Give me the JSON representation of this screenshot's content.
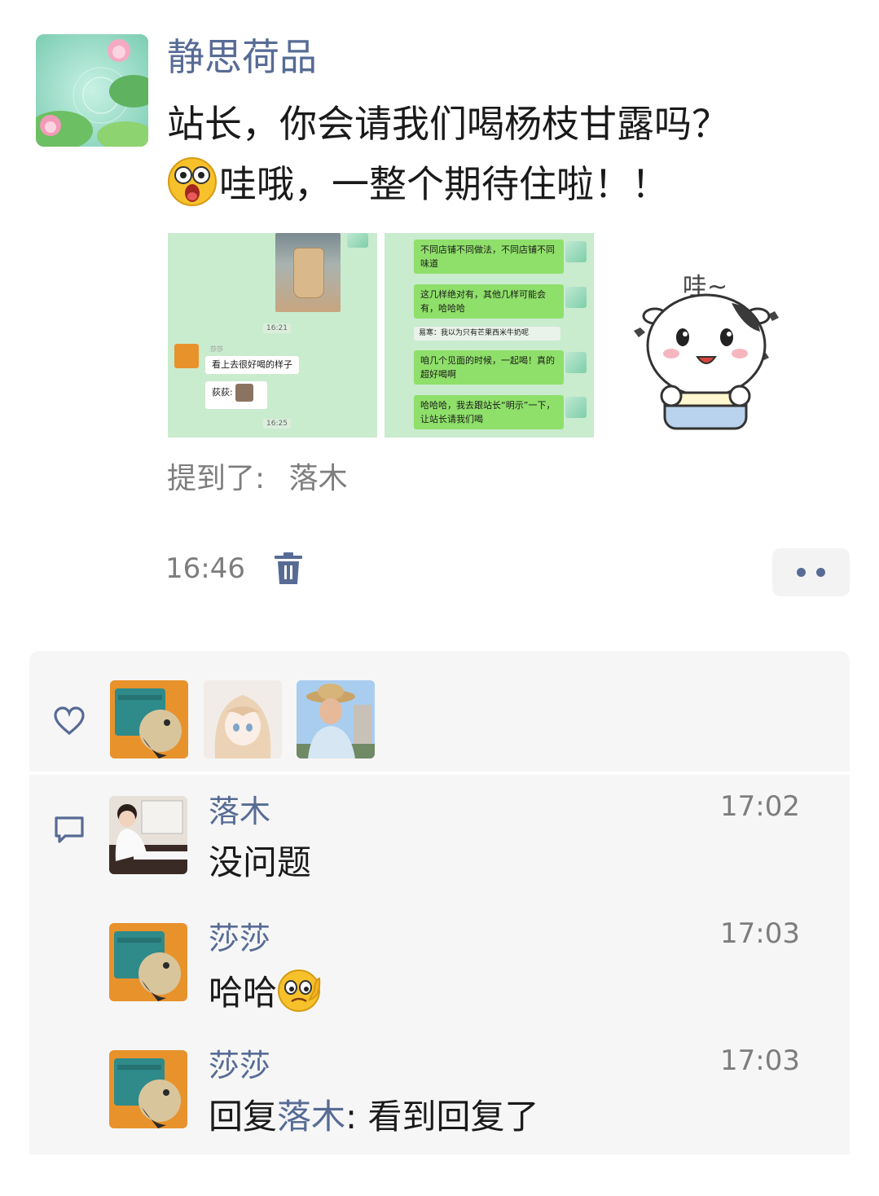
{
  "post": {
    "author": "静思荷品",
    "text_line1": "站长，你会请我们喝杨枝甘露吗？",
    "text_line2": "哇哦，一整个期待住啦！！",
    "images": [
      {
        "messages": [
          {
            "kind": "time",
            "text": "16:21"
          },
          {
            "kind": "name",
            "text": "莎莎"
          },
          {
            "kind": "bubble",
            "text": "看上去很好喝的样子"
          },
          {
            "kind": "bubble",
            "text": "荻荻:"
          },
          {
            "kind": "time",
            "text": "16:25"
          }
        ]
      },
      {
        "messages": [
          {
            "kind": "bubble",
            "text": "不同店铺不同做法，不同店铺不同味道"
          },
          {
            "kind": "bubble",
            "text": "这几样绝对有，其他几样可能会有，哈哈哈"
          },
          {
            "kind": "quote",
            "text": "易寒：我以为只有芒果西米牛奶呢"
          },
          {
            "kind": "bubble",
            "text": "咱几个见面的时候，一起喝！真的超好喝啊"
          },
          {
            "kind": "bubble",
            "text": "哈哈哈，我去跟站长“明示”一下，让站长请我们喝"
          }
        ]
      },
      {
        "sticker_text": "哇~"
      }
    ],
    "mention_label": "提到了:",
    "mention_name": "落木",
    "time": "16:46",
    "icons": {
      "delete": "trash-icon",
      "more": "more-dots-icon"
    }
  },
  "likes": {
    "icon": "heart-icon",
    "avatars": [
      "cat-avatar",
      "anime-girl-avatar",
      "hat-person-avatar"
    ]
  },
  "comments": [
    {
      "name": "落木",
      "time": "17:02",
      "text": "没问题",
      "avatar": "piano-child-avatar"
    },
    {
      "name": "莎莎",
      "time": "17:03",
      "text": "哈哈",
      "emoji": "smirk-emoji",
      "avatar": "cat-avatar"
    },
    {
      "name": "莎莎",
      "time": "17:03",
      "reply_prefix": "回复",
      "reply_to": "落木",
      "reply_sep": ": ",
      "text": "看到回复了",
      "avatar": "cat-avatar"
    }
  ],
  "colors": {
    "link": "#576b95",
    "muted": "#7d7d7d",
    "panel": "#f6f6f6"
  }
}
